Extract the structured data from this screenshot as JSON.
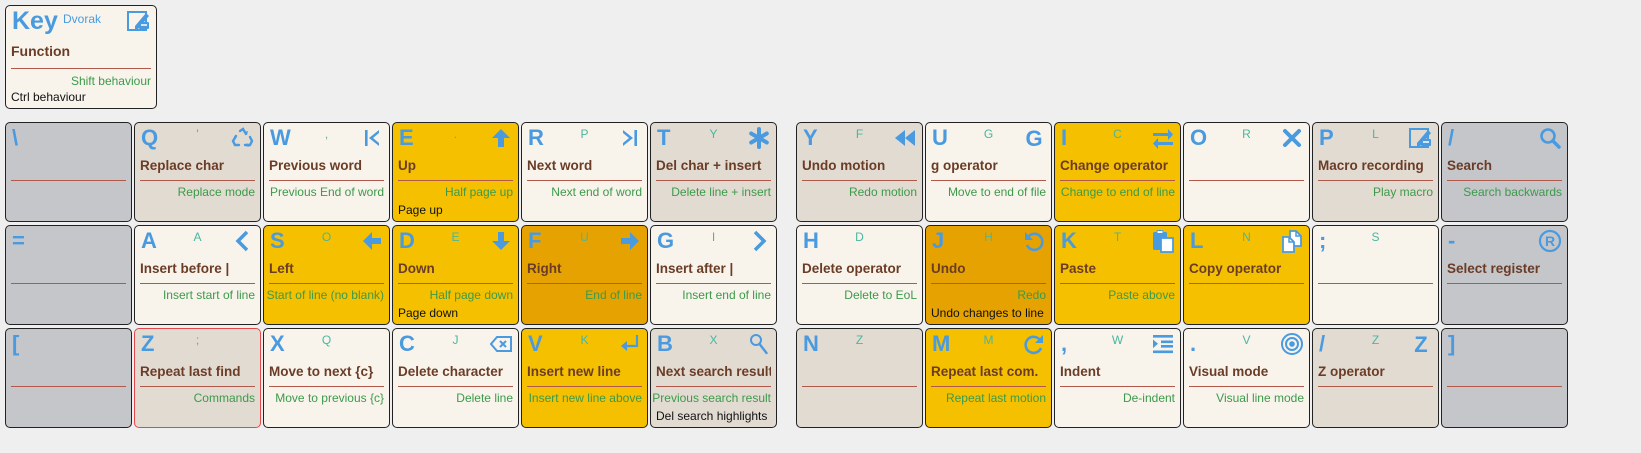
{
  "colors": {
    "gray": "#c5c6ca",
    "beige": "#e2dbd2",
    "cream": "#f8f4ec",
    "yellow": "#f4c000",
    "orange": "#e5a200",
    "icon": "#4a9ae0",
    "function_text": "#6b3c26",
    "shift_text": "#3c9a4a",
    "highlight_border": "#e04a4a"
  },
  "legend": {
    "key": "Key",
    "alt": "Dvorak",
    "icon": "macro-recording-icon",
    "function": "Function",
    "shift": "Shift behaviour",
    "ctrl": "Ctrl behaviour"
  },
  "rows": [
    [
      {
        "id": "backslash",
        "key": "\\",
        "alt": "",
        "function": "",
        "shift": "",
        "ctrl": "",
        "icon": "",
        "color": "gray"
      },
      {
        "id": "q",
        "key": "Q",
        "alt": "'",
        "function": "Replace char",
        "shift": "Replace mode",
        "ctrl": "",
        "icon": "recycle-icon",
        "color": "beige"
      },
      {
        "id": "w",
        "key": "W",
        "alt": ",",
        "function": "Previous word",
        "shift": "Previous End of word",
        "ctrl": "",
        "icon": "skip-back-icon",
        "color": "cream"
      },
      {
        "id": "e",
        "key": "E",
        "alt": ".",
        "function": "Up",
        "shift": "Half page up",
        "ctrl": "Page up",
        "icon": "arrow-up-icon",
        "color": "yellow"
      },
      {
        "id": "r",
        "key": "R",
        "alt": "P",
        "function": "Next word",
        "shift": "Next end of word",
        "ctrl": "",
        "icon": "skip-forward-icon",
        "color": "cream"
      },
      {
        "id": "t",
        "key": "T",
        "alt": "Y",
        "function": "Del char + insert",
        "shift": "Delete line + insert",
        "ctrl": "",
        "icon": "asterisk-icon",
        "color": "beige"
      },
      {
        "id": "y",
        "key": "Y",
        "alt": "F",
        "function": "Undo motion",
        "shift": "Redo motion",
        "ctrl": "",
        "icon": "rewind-icon",
        "color": "beige"
      },
      {
        "id": "u",
        "key": "U",
        "alt": "G",
        "function": "g operator",
        "shift": "Move to end of file",
        "ctrl": "",
        "icon": "letter-g-icon",
        "color": "cream"
      },
      {
        "id": "i",
        "key": "I",
        "alt": "C",
        "function": "Change operator",
        "shift": "Change to end of line",
        "ctrl": "",
        "icon": "swap-icon",
        "color": "yellow"
      },
      {
        "id": "o",
        "key": "O",
        "alt": "R",
        "function": "",
        "shift": "",
        "ctrl": "",
        "icon": "close-icon",
        "color": "cream"
      },
      {
        "id": "p",
        "key": "P",
        "alt": "L",
        "function": "Macro recording",
        "shift": "Play macro",
        "ctrl": "",
        "icon": "macro-recording-icon",
        "color": "beige"
      },
      {
        "id": "slash",
        "key": "/",
        "alt": "",
        "function": "Search",
        "shift": "Search backwards",
        "ctrl": "",
        "icon": "search-icon",
        "color": "gray"
      }
    ],
    [
      {
        "id": "equals",
        "key": "=",
        "alt": "",
        "function": "",
        "shift": "",
        "ctrl": "",
        "icon": "",
        "color": "gray"
      },
      {
        "id": "a",
        "key": "A",
        "alt": "A",
        "function": "Insert before |",
        "shift": "Insert start of line",
        "ctrl": "",
        "icon": "chevron-left-icon",
        "color": "cream"
      },
      {
        "id": "s",
        "key": "S",
        "alt": "O",
        "function": "Left",
        "shift": "Start of line (no blank)",
        "ctrl": "",
        "icon": "arrow-left-icon",
        "color": "yellow"
      },
      {
        "id": "d",
        "key": "D",
        "alt": "E",
        "function": "Down",
        "shift": "Half page down",
        "ctrl": "Page down",
        "icon": "arrow-down-icon",
        "color": "yellow"
      },
      {
        "id": "f",
        "key": "F",
        "alt": "U",
        "function": "Right",
        "shift": "End of line",
        "ctrl": "",
        "icon": "arrow-right-icon",
        "color": "orange"
      },
      {
        "id": "g",
        "key": "G",
        "alt": "I",
        "function": "Insert after |",
        "shift": "Insert end of line",
        "ctrl": "",
        "icon": "chevron-right-icon",
        "color": "cream"
      },
      {
        "id": "h",
        "key": "H",
        "alt": "D",
        "function": "Delete operator",
        "shift": "Delete to EoL",
        "ctrl": "",
        "icon": "",
        "color": "cream"
      },
      {
        "id": "j",
        "key": "J",
        "alt": "H",
        "function": "Undo",
        "shift": "Redo",
        "ctrl": "Undo changes to line",
        "icon": "undo-icon",
        "color": "orange"
      },
      {
        "id": "k",
        "key": "K",
        "alt": "T",
        "function": "Paste",
        "shift": "Paste above",
        "ctrl": "",
        "icon": "paste-icon",
        "color": "yellow"
      },
      {
        "id": "l",
        "key": "L",
        "alt": "N",
        "function": "Copy operator",
        "shift": "",
        "ctrl": "",
        "icon": "copy-icon",
        "color": "yellow"
      },
      {
        "id": "semicolon",
        "key": ";",
        "alt": "S",
        "function": "",
        "shift": "",
        "ctrl": "",
        "icon": "",
        "color": "cream"
      },
      {
        "id": "minus",
        "key": "-",
        "alt": "",
        "function": "Select register",
        "shift": "",
        "ctrl": "",
        "icon": "registered-icon",
        "color": "gray"
      }
    ],
    [
      {
        "id": "bracket-left",
        "key": "[",
        "alt": "",
        "function": "",
        "shift": "",
        "ctrl": "",
        "icon": "",
        "color": "gray"
      },
      {
        "id": "z",
        "key": "Z",
        "alt": ";",
        "function": "Repeat last find",
        "shift": "Commands",
        "ctrl": "",
        "icon": "",
        "color": "beige",
        "highlight": true
      },
      {
        "id": "x",
        "key": "X",
        "alt": "Q",
        "function": "Move to next {c}",
        "shift": "Move to previous {c}",
        "ctrl": "",
        "icon": "",
        "color": "cream"
      },
      {
        "id": "c",
        "key": "C",
        "alt": "J",
        "function": "Delete character",
        "shift": "Delete line",
        "ctrl": "",
        "icon": "backspace-icon",
        "color": "cream"
      },
      {
        "id": "v",
        "key": "V",
        "alt": "K",
        "function": "Insert new line",
        "shift": "Insert new line above",
        "ctrl": "",
        "icon": "return-icon",
        "color": "yellow"
      },
      {
        "id": "b",
        "key": "B",
        "alt": "X",
        "function": "Next search result",
        "shift": "Previous search result",
        "ctrl": "Del search highlights",
        "icon": "search-small-icon",
        "color": "beige"
      },
      {
        "id": "n",
        "key": "N",
        "alt": "Z",
        "function": "",
        "shift": "",
        "ctrl": "",
        "icon": "",
        "color": "beige"
      },
      {
        "id": "m",
        "key": "M",
        "alt": "M",
        "function": "Repeat last com.",
        "shift": "Repeat last motion",
        "ctrl": "",
        "icon": "redo-icon",
        "color": "yellow"
      },
      {
        "id": "comma",
        "key": ",",
        "alt": "W",
        "function": "Indent",
        "shift": "De-indent",
        "ctrl": "",
        "icon": "indent-icon",
        "color": "cream"
      },
      {
        "id": "period",
        "key": ".",
        "alt": "V",
        "function": "Visual mode",
        "shift": "Visual line mode",
        "ctrl": "",
        "icon": "target-icon",
        "color": "cream"
      },
      {
        "id": "slash2",
        "key": "/",
        "alt": "Z",
        "function": "Z operator",
        "shift": "",
        "ctrl": "",
        "icon": "letter-z-icon",
        "color": "beige"
      },
      {
        "id": "bracket-right",
        "key": "]",
        "alt": "",
        "function": "",
        "shift": "",
        "ctrl": "",
        "icon": "",
        "color": "gray"
      }
    ]
  ]
}
